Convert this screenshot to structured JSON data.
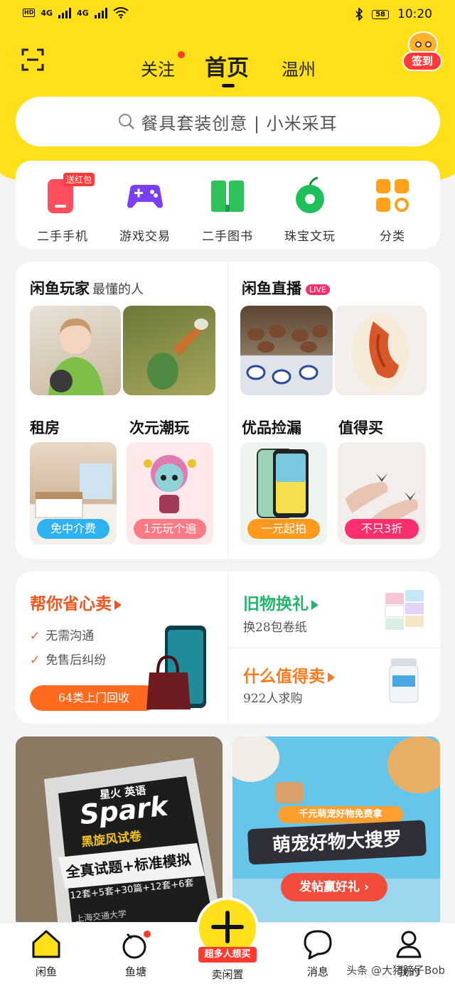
{
  "status_bar": {
    "time": "10:20",
    "battery": "58",
    "network_1": "4G",
    "network_2": "4G",
    "hd": "HD"
  },
  "header": {
    "tabs": [
      {
        "label": "关注"
      },
      {
        "label": "首页"
      },
      {
        "label": "温州"
      }
    ],
    "checkin_label": "签到"
  },
  "search": {
    "placeholder": "餐具套装创意 | 小米采耳"
  },
  "categories": [
    {
      "label": "二手手机",
      "badge": "送红包",
      "icon": "phone-icon"
    },
    {
      "label": "游戏交易",
      "icon": "gamepad-icon"
    },
    {
      "label": "二手图书",
      "icon": "book-icon"
    },
    {
      "label": "珠宝文玩",
      "icon": "jade-icon"
    },
    {
      "label": "分类",
      "icon": "grid-icon"
    }
  ],
  "features": {
    "player": {
      "title": "闲鱼玩家",
      "subtitle": "最懂的人"
    },
    "live": {
      "title": "闲鱼直播",
      "badge": "LIVE"
    },
    "tiles": [
      {
        "title": "租房",
        "tag": "免中介费",
        "tag_color": "#2fb3f0"
      },
      {
        "title": "次元潮玩",
        "tag": "1元玩个遍",
        "tag_color": "#ff7a85"
      },
      {
        "title": "优品捡漏",
        "tag": "一元起拍",
        "tag_color": "#ff9a1f"
      },
      {
        "title": "值得买",
        "tag": "不只3折",
        "tag_color": "#ff2f6d"
      }
    ]
  },
  "promo": {
    "sell": {
      "title": "帮你省心卖",
      "points": [
        "无需沟通",
        "免售后纠纷"
      ],
      "button": "64类上门回收"
    },
    "exchange": {
      "title": "旧物换礼",
      "subtitle": "换28包卷纸"
    },
    "worth": {
      "title": "什么值得卖",
      "subtitle": "922人求购"
    }
  },
  "feed": {
    "card1": {
      "brand_small": "星火 英语",
      "brand": "Spark",
      "line1": "黑旋风试卷",
      "line2": "全真试题+标准模拟",
      "line3": "12套+5套+30篇+12套+6套",
      "footer": "上海交通大学"
    },
    "card2": {
      "banner": "千元萌宠好物免费拿",
      "title": "萌宠好物大搜罗",
      "button": "发帖赢好礼 ›"
    }
  },
  "bottom_nav": {
    "items": [
      {
        "label": "闲鱼"
      },
      {
        "label": "鱼塘"
      },
      {
        "label": "卖闲置"
      },
      {
        "label": "消息"
      },
      {
        "label": "我的"
      }
    ],
    "fab_tag": "超多人想买"
  },
  "watermark": "头条 @大猪蹄子Bob"
}
